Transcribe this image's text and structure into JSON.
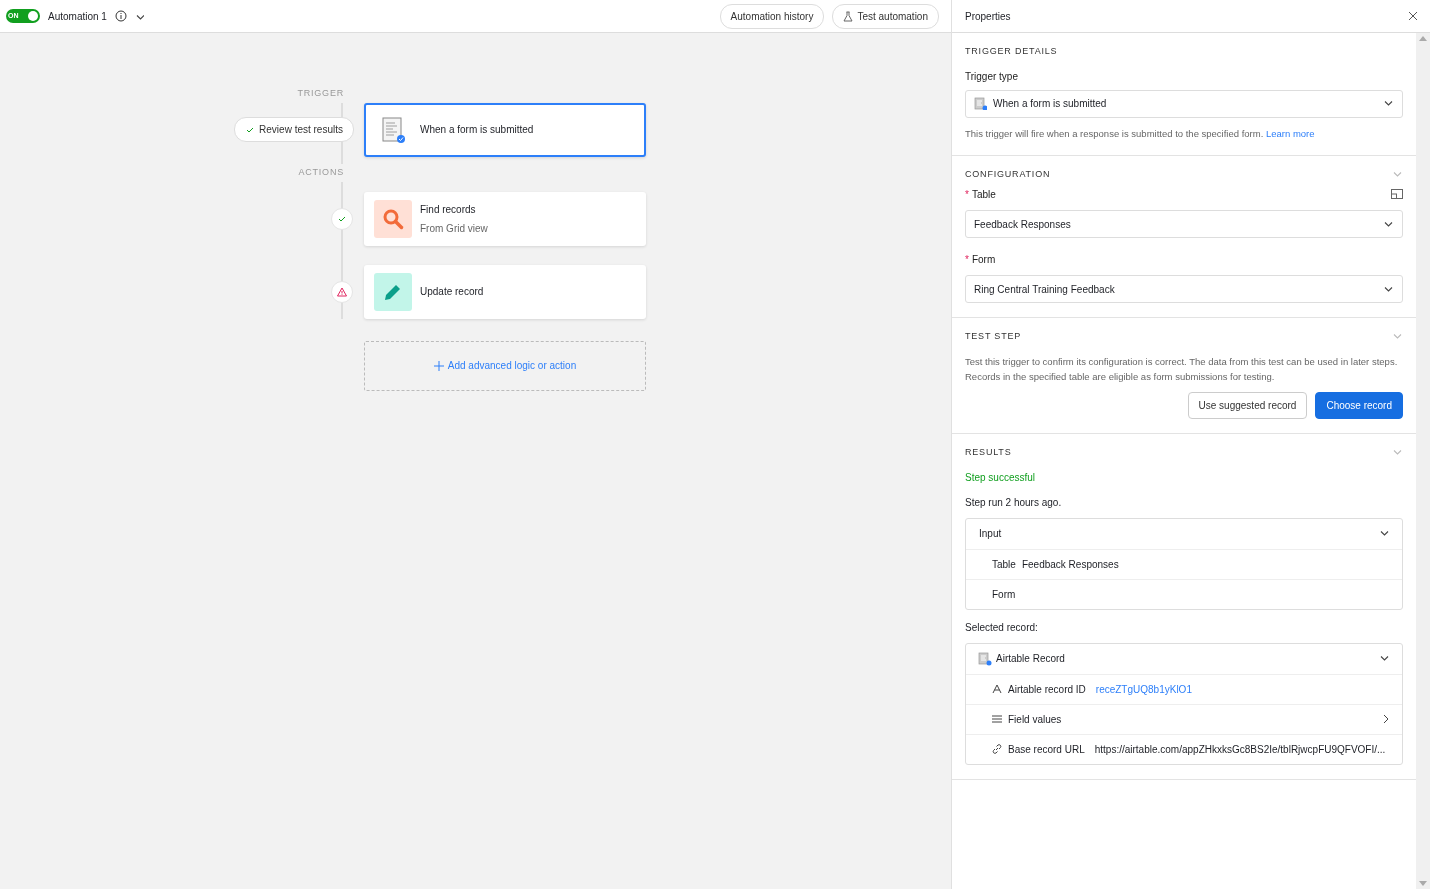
{
  "toolbar": {
    "toggle": {
      "label": "ON",
      "on": true
    },
    "title": "Automation 1",
    "buttons": [
      {
        "kind": "history",
        "label": "Automation history"
      },
      {
        "kind": "test",
        "label": "Test automation"
      }
    ]
  },
  "canvas": {
    "trigger_label": "TRIGGER",
    "review_button": "Review test results",
    "trigger_step": {
      "title": "When a form is submitted",
      "selected": true
    },
    "actions_label": "ACTIONS",
    "actions": [
      {
        "kind": "find",
        "title": "Find records",
        "subtitle": "From Grid view",
        "warning": false,
        "selected": false
      },
      {
        "kind": "update",
        "title": "Update record",
        "warning": true,
        "selected": false
      }
    ],
    "add_button": "Add advanced logic or action"
  },
  "properties": {
    "title": "Properties",
    "trigger_details": {
      "heading": "TRIGGER DETAILS",
      "label": "Trigger type",
      "value": "When a form is submitted",
      "help": "This trigger will fire when a response is submitted to the specified form.",
      "link": "Learn more"
    },
    "configuration": {
      "heading": "CONFIGURATION",
      "fields": [
        {
          "label": "Table",
          "value": "Feedback Responses",
          "required_mark": "*"
        },
        {
          "label": "Form",
          "value": "Ring Central Training Feedback",
          "required_mark": "*"
        }
      ]
    },
    "test_step": {
      "heading": "TEST STEP",
      "text": "Test this trigger to confirm its configuration is correct. The data from this test can be used in later steps. Records in the specified table are eligible as form submissions for testing.",
      "buttons": [
        {
          "kind": "secondary",
          "label": "Use suggested record"
        },
        {
          "kind": "primary",
          "label": "Choose record"
        }
      ]
    },
    "results": {
      "heading": "RESULTS",
      "status": "Step successful",
      "run": "Step run 2 hours ago.",
      "input": {
        "title": "Input",
        "expanded": true,
        "rows": [
          {
            "label": "Table",
            "value": "Feedback Responses"
          },
          {
            "label": "Form"
          }
        ]
      },
      "selected_label": "Selected record:",
      "record": {
        "title": "Airtable Record",
        "expanded": true,
        "rows": [
          {
            "kind": "id",
            "label": "Airtable record ID",
            "value": "receZTgUQ8b1yKlO1"
          },
          {
            "kind": "fields",
            "label": "Field values"
          },
          {
            "kind": "url",
            "label": "Base record URL",
            "value": "https://airtable.com/appZHkxksGc8BS2Ie/tblRjwcpFU9QFVOFI/..."
          }
        ]
      }
    }
  }
}
